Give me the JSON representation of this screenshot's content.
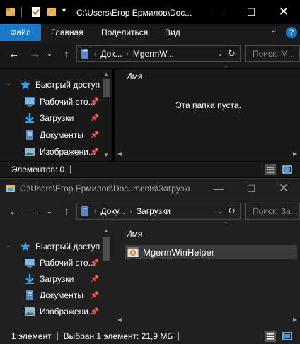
{
  "window1": {
    "title": "C:\\Users\\Егор Ермилов\\Doc...",
    "ribbon_tabs": [
      "Файл",
      "Главная",
      "Поделиться",
      "Вид"
    ],
    "breadcrumb": [
      "Док...",
      "MgermW..."
    ],
    "search_placeholder": "Поиск: М...",
    "column_header": "Имя",
    "empty_message": "Эта папка пуста.",
    "status_text": "Элементов: 0",
    "nav_items": [
      {
        "label": "Быстрый доступ",
        "icon": "star-icon"
      },
      {
        "label": "Рабочий сто...",
        "icon": "desktop-icon"
      },
      {
        "label": "Загрузки",
        "icon": "download-icon"
      },
      {
        "label": "Документы",
        "icon": "documents-icon"
      },
      {
        "label": "Изображени...",
        "icon": "pictures-icon"
      }
    ]
  },
  "window2": {
    "title": "C:\\Users\\Егор Ермилов\\Documents\\Загрузки",
    "breadcrumb": [
      "Доку...",
      "Загрузки"
    ],
    "search_placeholder": "Поиск: За...",
    "column_header": "Имя",
    "files": [
      {
        "name": "MgermWinHelper",
        "selected": true
      }
    ],
    "status_count": "1 элемент",
    "status_selection": "Выбран 1 элемент: 21,9 МБ",
    "nav_items": [
      {
        "label": "Быстрый доступ",
        "icon": "star-icon"
      },
      {
        "label": "Рабочий сто...",
        "icon": "desktop-icon"
      },
      {
        "label": "Загрузки",
        "icon": "download-icon"
      },
      {
        "label": "Документы",
        "icon": "documents-icon"
      },
      {
        "label": "Изображени...",
        "icon": "pictures-icon"
      }
    ]
  },
  "colors": {
    "accent": "#1979ca",
    "window_bg": "#191919",
    "selection": "#3b3b3b",
    "folder": "#e8b64a"
  }
}
